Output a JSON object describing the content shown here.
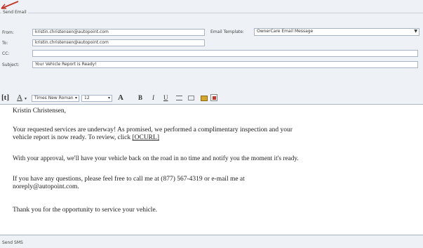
{
  "groupbox": {
    "title": "Send Email"
  },
  "labels": {
    "from": "From:",
    "to": "To:",
    "cc": "CC:",
    "subject": "Subject:",
    "template": "Email Template:"
  },
  "fields": {
    "from": "kristin.christensen@autopoint.com",
    "to": "kristin.christensen@autopoint.com",
    "cc": "",
    "subject": "Your Vehicle Report is Ready!",
    "template": "OwnerCare Email Message"
  },
  "toolbar": {
    "font_name": "Times New Roman",
    "font_size": "12"
  },
  "body": {
    "greeting": "Kristin Christensen,",
    "p1a": "Your requested services are underway! As promised, we performed a complimentary inspection and your",
    "p1b": "vehicle report is now ready.  To review, click ",
    "link": "[OCURL]",
    "p2": "With your approval, we'll have your vehicle back on the road in no time and notify you the moment it's ready.",
    "p3a": "If you have any questions, please feel free to call me at (877) 567-4319 or e-mail me at",
    "p3b": "noreply@autopoint.com.",
    "p4": "Thank you for the opportunity to service your vehicle."
  },
  "footer": {
    "label": "Send SMS"
  },
  "colors": {
    "background": "#eef1f5",
    "border": "#a9b4c2",
    "arrow": "#c0392b"
  }
}
